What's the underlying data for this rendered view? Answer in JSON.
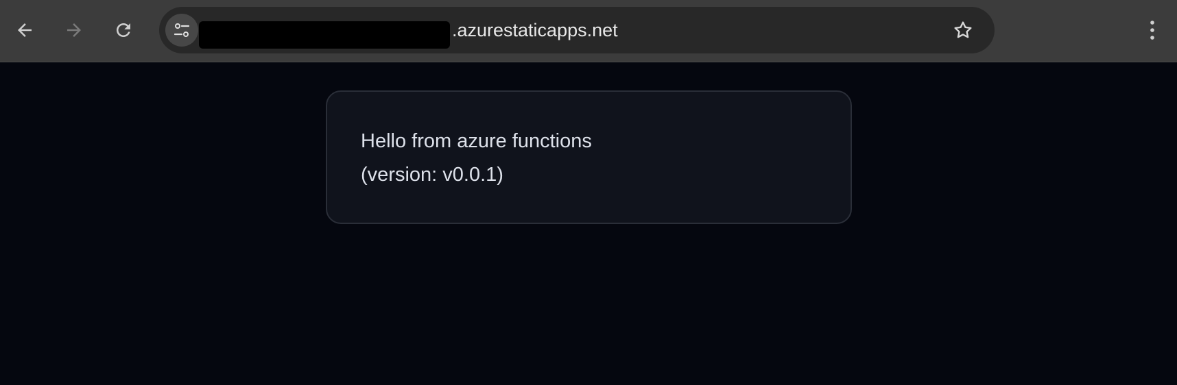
{
  "browser": {
    "url_visible_suffix": ".azurestaticapps.net",
    "icons": {
      "back": "arrow-left-icon",
      "forward": "arrow-right-icon",
      "reload": "reload-icon",
      "site_info": "tune-icon",
      "bookmark": "star-icon",
      "menu": "more-vert-icon"
    }
  },
  "page": {
    "message_line_1": "Hello from azure functions",
    "message_line_2": "(version: v0.0.1)"
  },
  "colors": {
    "page_background": "#05070f",
    "card_background": "#10131c",
    "toolbar_background": "#3c3c3c"
  }
}
